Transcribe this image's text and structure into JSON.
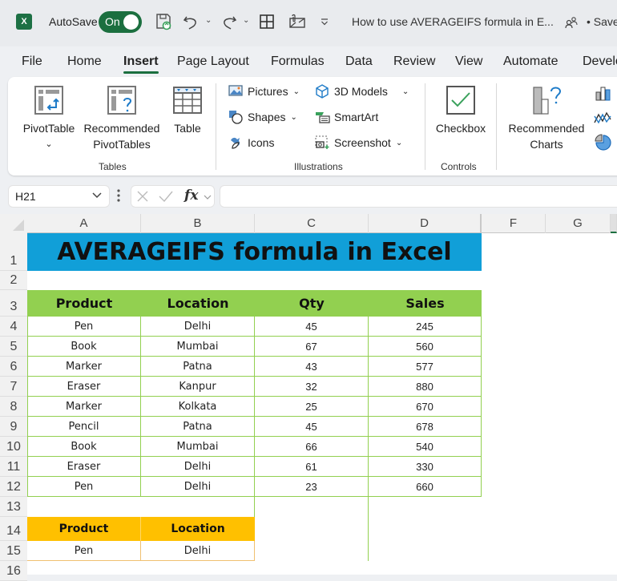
{
  "titlebar": {
    "app_icon": "excel-logo-icon",
    "app_letter": "X",
    "autosave_label": "AutoSave",
    "autosave_state": "On",
    "quick_access": [
      "save-sync-icon",
      "undo-icon",
      "redo-icon",
      "borders-icon",
      "email-icon",
      "customize-qat-icon"
    ],
    "document_title": "How to use AVERAGEIFS formula in E...",
    "collab_icon": "people-icon",
    "save_status": "• Saved"
  },
  "ribbon_tabs": [
    {
      "label": "File",
      "active": false
    },
    {
      "label": "Home",
      "active": false
    },
    {
      "label": "Insert",
      "active": true
    },
    {
      "label": "Page Layout",
      "active": false
    },
    {
      "label": "Formulas",
      "active": false
    },
    {
      "label": "Data",
      "active": false
    },
    {
      "label": "Review",
      "active": false
    },
    {
      "label": "View",
      "active": false
    },
    {
      "label": "Automate",
      "active": false
    },
    {
      "label": "Developer",
      "active": false
    }
  ],
  "ribbon": {
    "groups": {
      "tables": {
        "label": "Tables",
        "pivottable": "PivotTable",
        "pivottable_caret": "⌄",
        "recommended_pivot_line1": "Recommended",
        "recommended_pivot_line2": "PivotTables",
        "table": "Table"
      },
      "illustrations": {
        "label": "Illustrations",
        "pictures": "Pictures",
        "shapes": "Shapes",
        "icons": "Icons",
        "models3d": "3D Models",
        "smartart": "SmartArt",
        "screenshot": "Screenshot"
      },
      "controls": {
        "label": "Controls",
        "checkbox": "Checkbox"
      },
      "charts": {
        "recommended_line1": "Recommended",
        "recommended_line2": "Charts"
      }
    }
  },
  "formula_bar": {
    "name_box": "H21",
    "fx_label": "fx",
    "formula_value": ""
  },
  "sheet": {
    "columns": [
      "A",
      "B",
      "C",
      "D",
      "F",
      "G"
    ],
    "rows": [
      "1",
      "2",
      "3",
      "4",
      "5",
      "6",
      "7",
      "8",
      "9",
      "10",
      "11",
      "12",
      "13",
      "14",
      "15",
      "16"
    ],
    "title": "AVERAGEIFS formula in Excel",
    "table_headers": [
      "Product",
      "Location",
      "Qty",
      "Sales"
    ],
    "table_rows": [
      [
        "Pen",
        "Delhi",
        "45",
        "245"
      ],
      [
        "Book",
        "Mumbai",
        "67",
        "560"
      ],
      [
        "Marker",
        "Patna",
        "43",
        "577"
      ],
      [
        "Eraser",
        "Kanpur",
        "32",
        "880"
      ],
      [
        "Marker",
        "Kolkata",
        "25",
        "670"
      ],
      [
        "Pencil",
        "Patna",
        "45",
        "678"
      ],
      [
        "Book",
        "Mumbai",
        "66",
        "540"
      ],
      [
        "Eraser",
        "Delhi",
        "61",
        "330"
      ],
      [
        "Pen",
        "Delhi",
        "23",
        "660"
      ]
    ],
    "criteria_headers": [
      "Product",
      "Location"
    ],
    "criteria_values": [
      "Pen",
      "Delhi"
    ],
    "colors": {
      "title_bg": "#119fd8",
      "header_bg": "#92d050",
      "criteria_bg": "#ffc000",
      "accent": "#1b6f3f"
    }
  }
}
